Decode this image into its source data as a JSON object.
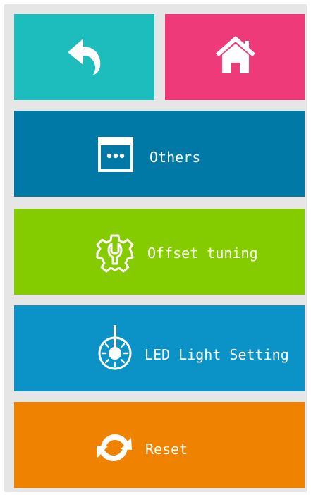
{
  "colors": {
    "back": "#1ebdbd",
    "home": "#ee3a79",
    "others": "#0079a7",
    "offset": "#84cc00",
    "led": "#0b93c7",
    "reset": "#ef8300"
  },
  "tiles": {
    "back": {
      "icon": "undo-arrow-icon"
    },
    "home": {
      "icon": "home-icon"
    },
    "others": {
      "label": "Others",
      "icon": "window-dots-icon"
    },
    "offset": {
      "label": "Offset tuning",
      "icon": "gear-wrench-icon"
    },
    "led": {
      "label": "LED Light Setting",
      "icon": "light-dial-icon"
    },
    "reset": {
      "label": "Reset",
      "icon": "refresh-arrows-icon"
    }
  }
}
